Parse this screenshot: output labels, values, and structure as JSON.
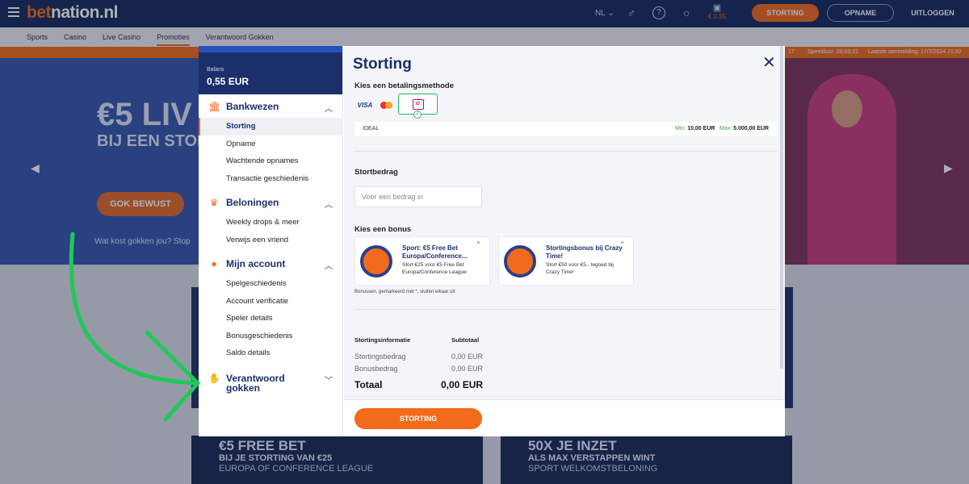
{
  "header": {
    "logo_part1": "bet",
    "logo_part2": "nation.nl",
    "language": "NL",
    "balance": "€ 0.55",
    "deposit_label": "STORTING",
    "withdraw_label": "OPNAME",
    "logout_label": "UITLOGGEN"
  },
  "nav": {
    "items": [
      "Sports",
      "Casino",
      "Live Casino",
      "Promoties",
      "Verantwoord Gokken"
    ],
    "active": "Promoties"
  },
  "strip": {
    "session_label": "Speelduur: 00:03:21",
    "last_login": "Laatste aanmelding: 17/7/2024 21:32",
    "left_fragment": "17"
  },
  "hero": {
    "title": "€5 LIV",
    "subtitle": "BIJ EEN STOR",
    "button": "GOK BEWUST",
    "note": "Wat kost gokken jou? Stop"
  },
  "promos": [
    {
      "line1": "€5 FREE BET",
      "line2": "BIJ JE STORTING VAN €25",
      "line3": "EUROPA OF CONFERENCE LEAGUE"
    },
    {
      "line1": "50X JE INZET",
      "line2": "ALS MAX VERSTAPPEN WINT",
      "line3": "SPORT WELKOMSTBELONING"
    }
  ],
  "modal": {
    "balance_label": "Balans",
    "balance_value": "0,55 EUR",
    "groups": [
      {
        "title": "Bankwezen",
        "icon": "bank-icon",
        "items": [
          "Storting",
          "Opname",
          "Wachtende opnames",
          "Transactie geschiedenis"
        ]
      },
      {
        "title": "Beloningen",
        "icon": "crown-icon",
        "items": [
          "Weekly drops & meer",
          "Verwijs een vriend"
        ]
      },
      {
        "title": "Mijn account",
        "icon": "user-icon",
        "items": [
          "Spelgeschiedenis",
          "Account verificatie",
          "Speler details",
          "Bonusgeschiedenis",
          "Saldo details"
        ]
      },
      {
        "title": "Verantwoord gokken",
        "icon": "hand-icon",
        "items": []
      }
    ],
    "active_item": "Storting",
    "title": "Storting",
    "payment_label": "Kies een betalingsmethode",
    "methods": [
      "VISA",
      "Mastercard",
      "iDEAL"
    ],
    "selected_method": "iDEAL",
    "method_name": "IDEAL",
    "min_label": "Min:",
    "min_value": "10,00 EUR",
    "max_label": "Max:",
    "max_value": "5.000,00 EUR",
    "amount_label": "Stortbedrag",
    "amount_placeholder": "Voer een bedrag in",
    "bonus_label": "Kies een bonus",
    "bonuses": [
      {
        "title": "Sport: €5 Free Bet Europa/Conference...",
        "desc": "Stort €25 voor €5 Free Bet Europa/Conference League",
        "star": "*"
      },
      {
        "title": "Stortingsbonus bij Crazy Time!",
        "desc": "Stort €50 voor €5,- tegoed bij Crazy Time!",
        "star": "*"
      }
    ],
    "bonus_note": "Bonussen, gemarkeerd met *, sluiten elkaar uit",
    "info_header": "Stortingsinformatie",
    "subtotal_header": "Subtotaal",
    "rows": [
      {
        "label": "Stortingsbedrag",
        "value": "0,00 EUR"
      },
      {
        "label": "Bonusbedrag",
        "value": "0,00 EUR"
      }
    ],
    "total_label": "Totaal",
    "total_value": "0,00 EUR",
    "deposit_button": "STORTING"
  }
}
